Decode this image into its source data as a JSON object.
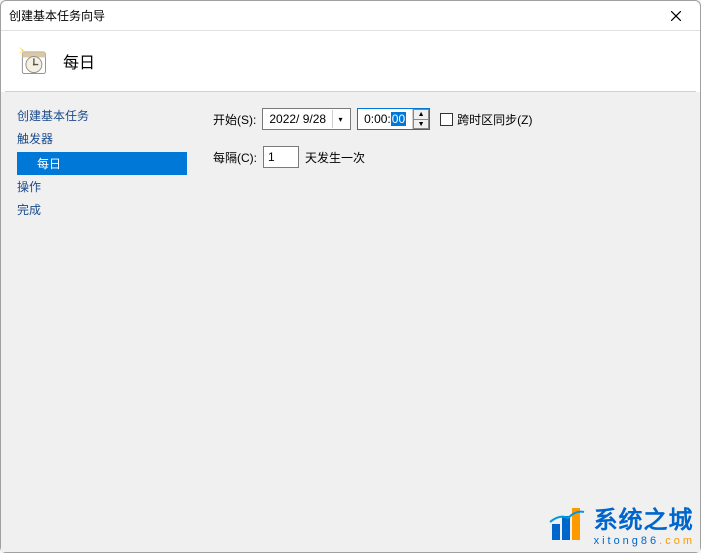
{
  "window": {
    "title": "创建基本任务向导"
  },
  "header": {
    "title": "每日"
  },
  "sidebar": {
    "items": [
      {
        "label": "创建基本任务",
        "type": "top"
      },
      {
        "label": "触发器",
        "type": "top"
      },
      {
        "label": "每日",
        "type": "sub",
        "selected": true
      },
      {
        "label": "操作",
        "type": "top"
      },
      {
        "label": "完成",
        "type": "top"
      }
    ]
  },
  "form": {
    "start_label": "开始(S):",
    "date_value": "2022/ 9/28",
    "time_prefix": "0:00:",
    "time_selected": "00",
    "sync_label": "跨时区同步(Z)",
    "interval_label": "每隔(C):",
    "interval_value": "1",
    "interval_suffix": "天发生一次"
  },
  "watermark": {
    "main": "系统之城",
    "sub_part1": "xitong86",
    "sub_part2": ".com"
  }
}
